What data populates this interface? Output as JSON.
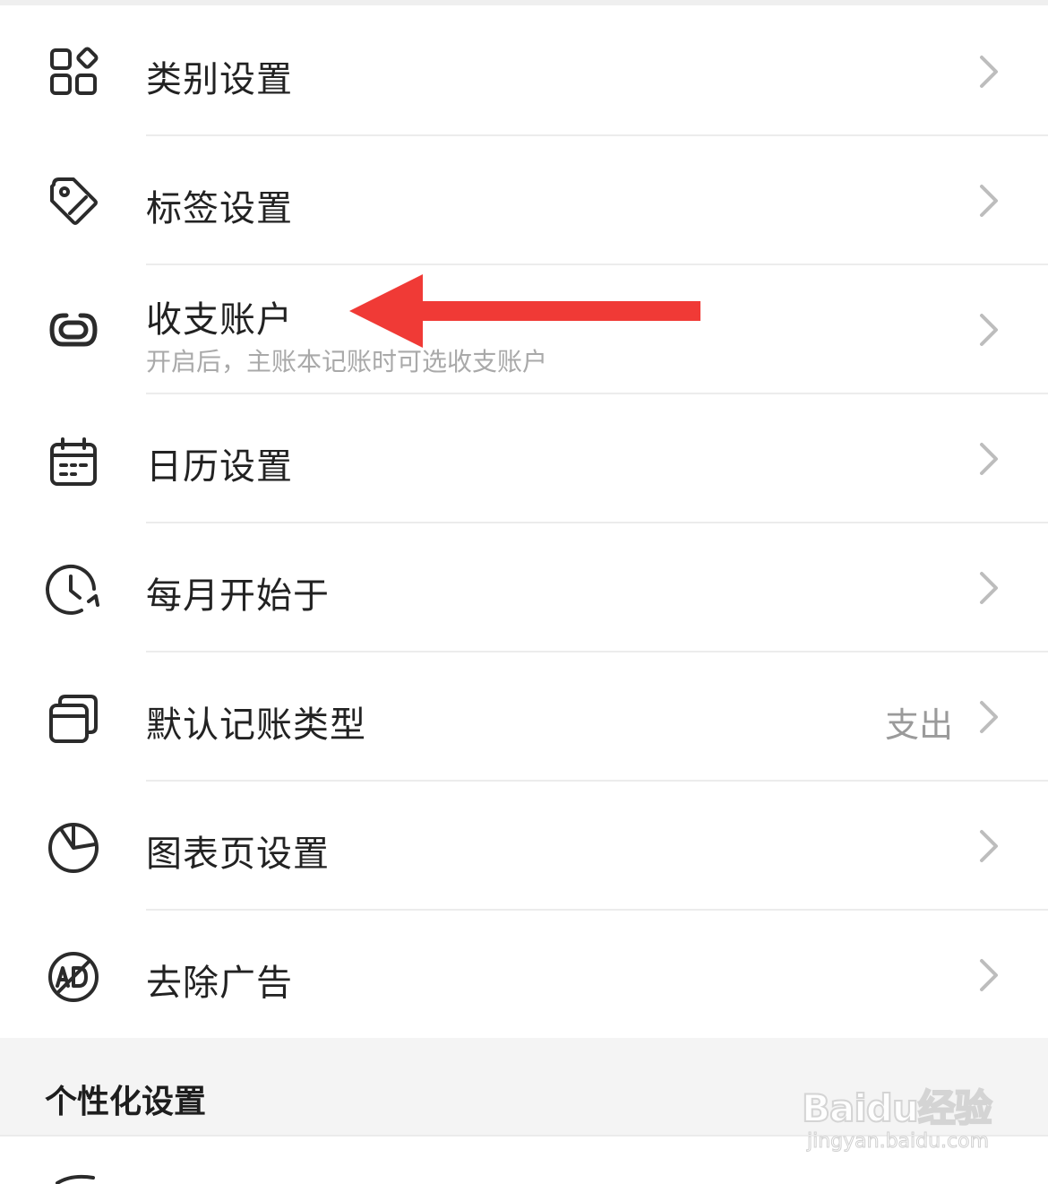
{
  "settings": {
    "items": [
      {
        "title": "类别设置",
        "icon": "grid-icon"
      },
      {
        "title": "标签设置",
        "icon": "tag-icon"
      },
      {
        "title": "收支账户",
        "subtitle": "开启后，主账本记账时可选收支账户",
        "icon": "link-icon"
      },
      {
        "title": "日历设置",
        "icon": "calendar-icon"
      },
      {
        "title": "每月开始于",
        "icon": "clock-icon"
      },
      {
        "title": "默认记账类型",
        "value": "支出",
        "icon": "stack-icon"
      },
      {
        "title": "图表页设置",
        "icon": "pie-chart-icon"
      },
      {
        "title": "去除广告",
        "icon": "no-ad-icon"
      }
    ]
  },
  "section": {
    "title": "个性化设置"
  },
  "watermark": {
    "brand": "Baidu经验",
    "url": "jingyan.baidu.com"
  },
  "colors": {
    "arrow": "#f03a36",
    "chevron": "#bdbdbd",
    "icon": "#2b2b2b"
  }
}
